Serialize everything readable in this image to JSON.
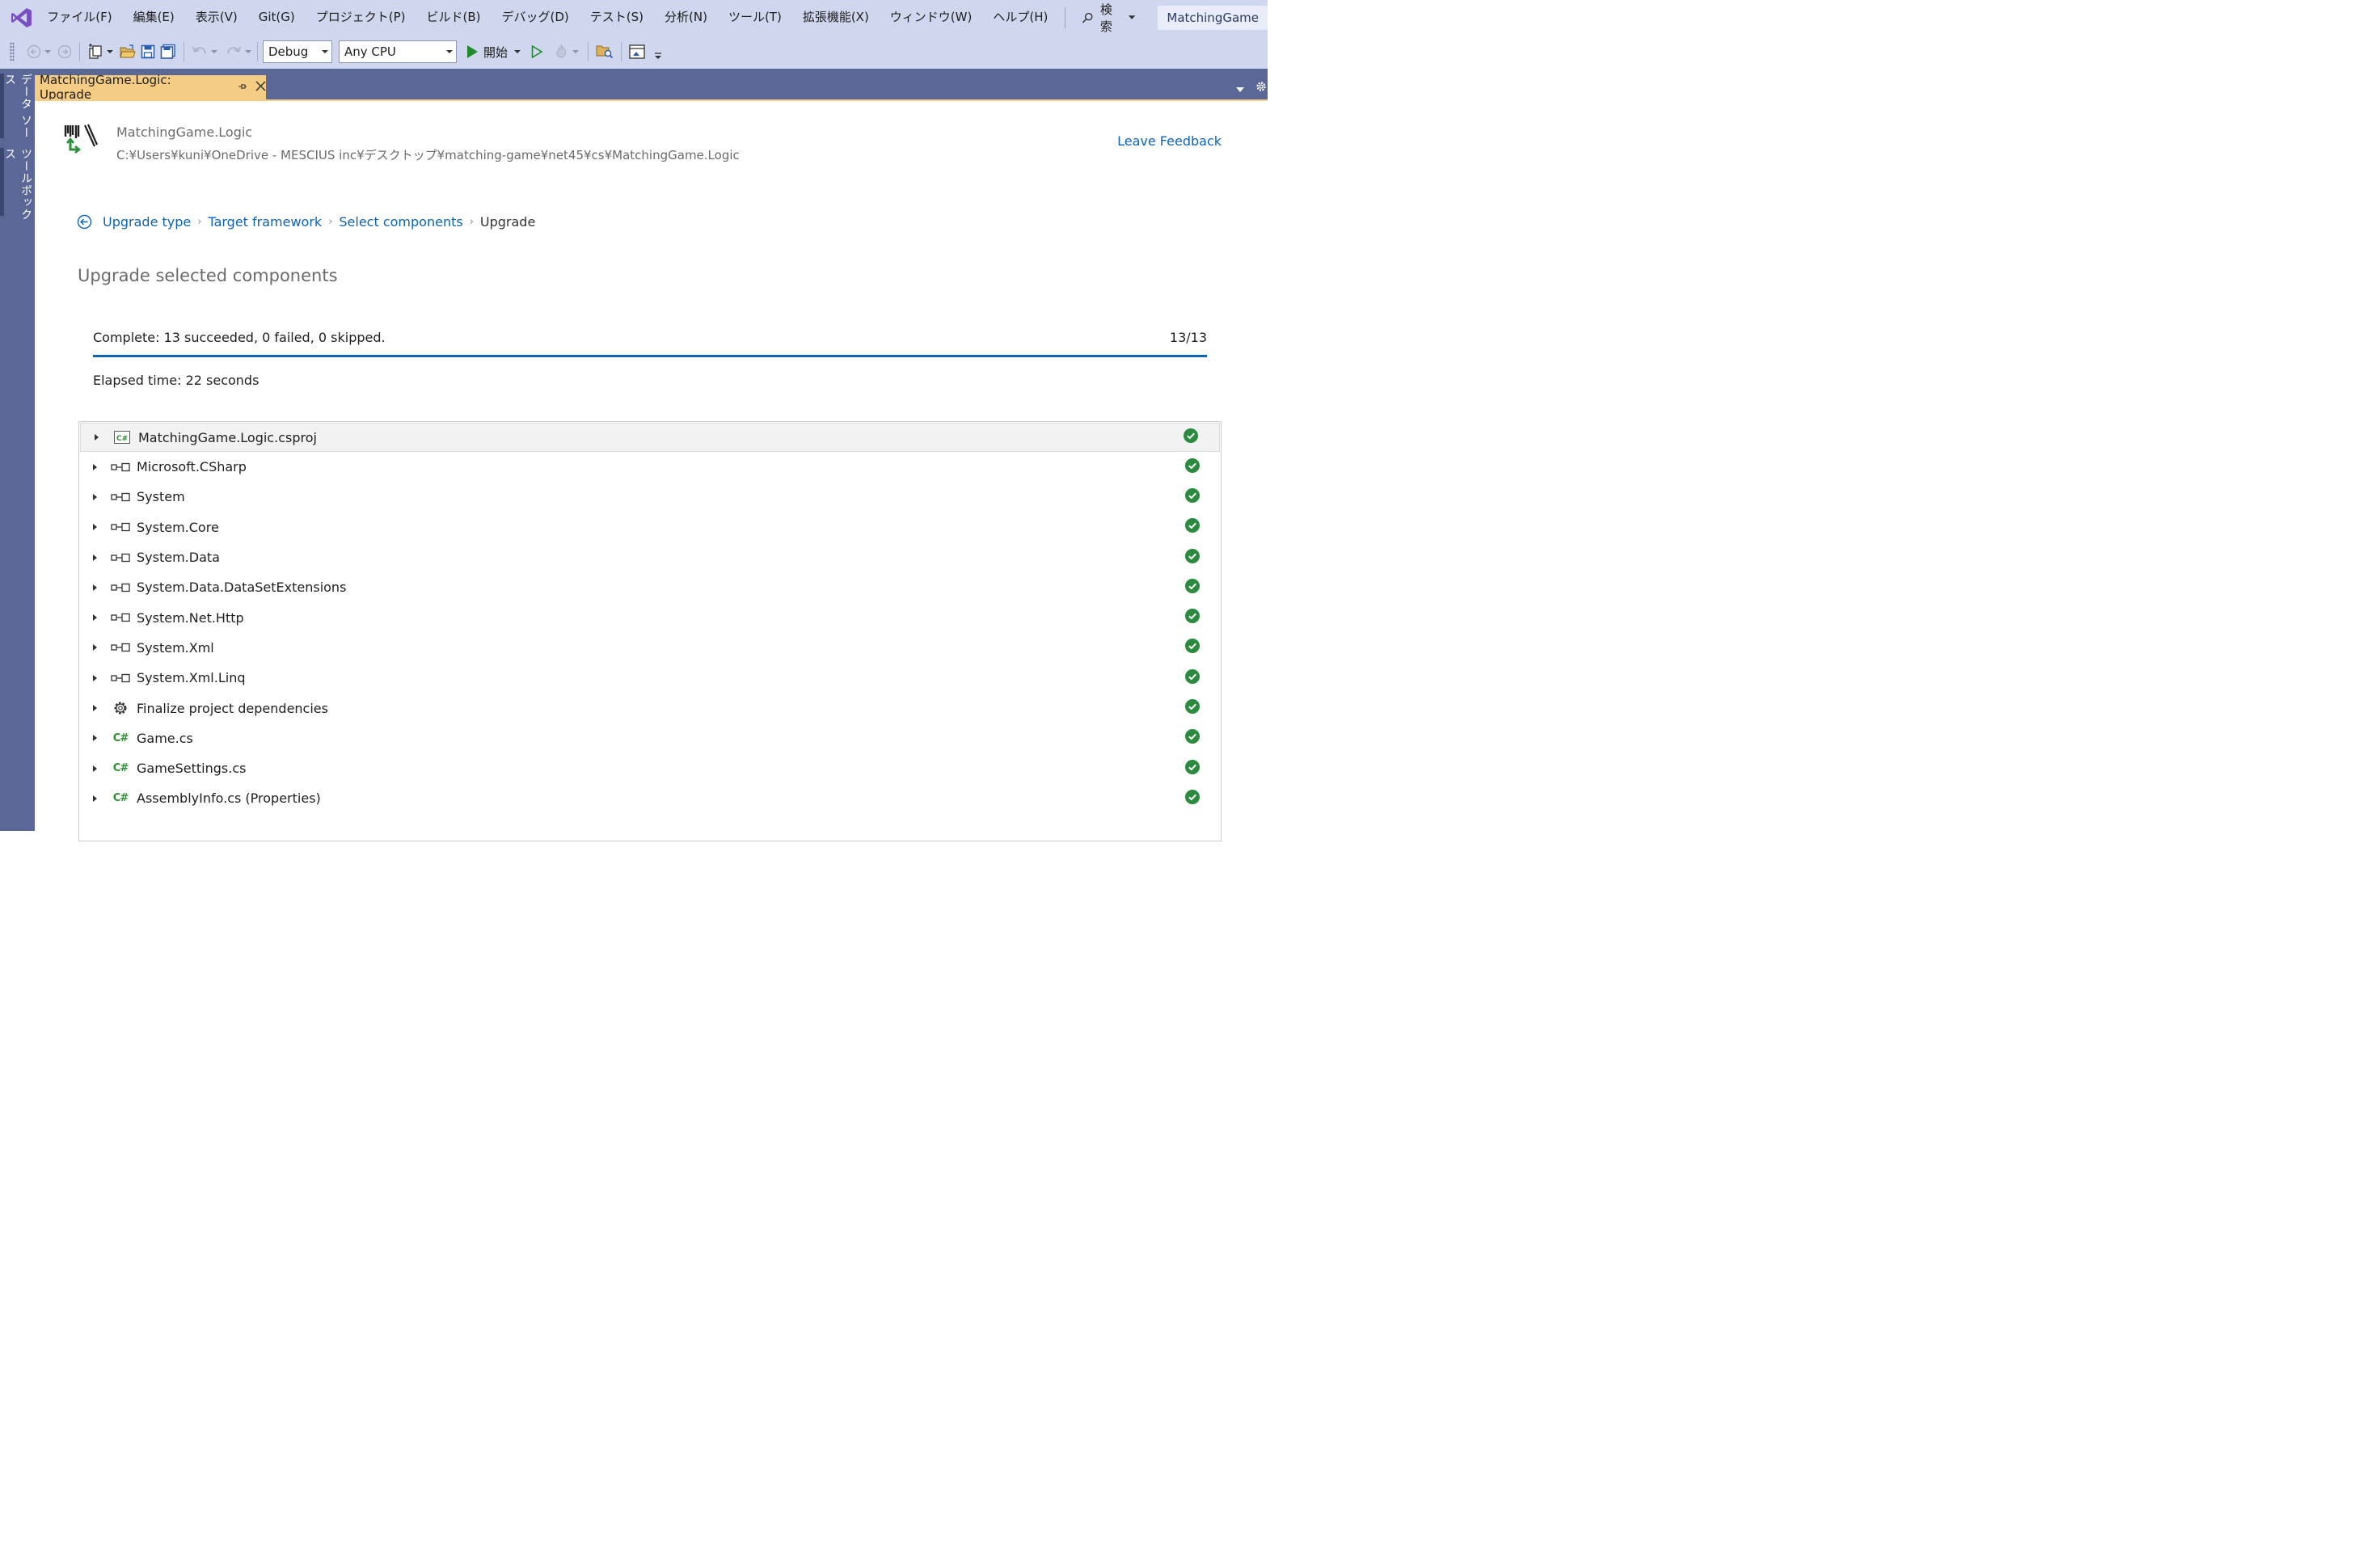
{
  "menubar": {
    "items": [
      "ファイル(F)",
      "編集(E)",
      "表示(V)",
      "Git(G)",
      "プロジェクト(P)",
      "ビルド(B)",
      "デバッグ(D)",
      "テスト(S)",
      "分析(N)",
      "ツール(T)",
      "拡張機能(X)",
      "ウィンドウ(W)",
      "ヘルプ(H)"
    ],
    "search_label": "検索",
    "solution_name": "MatchingGame"
  },
  "toolbar": {
    "config": "Debug",
    "platform": "Any CPU",
    "start_label": "開始"
  },
  "left_tabs": [
    "データ ソース",
    "ツールボックス"
  ],
  "document_tab": {
    "title": "MatchingGame.Logic: Upgrade"
  },
  "header": {
    "project_name": "MatchingGame.Logic",
    "project_path": "C:¥Users¥kuni¥OneDrive - MESCIUS inc¥デスクトップ¥matching-game¥net45¥cs¥MatchingGame.Logic",
    "feedback_link": "Leave Feedback"
  },
  "breadcrumb": {
    "steps": [
      "Upgrade type",
      "Target framework",
      "Select components"
    ],
    "current": "Upgrade"
  },
  "section_title": "Upgrade selected components",
  "status": {
    "summary": "Complete: 13 succeeded, 0 failed, 0 skipped.",
    "count": "13/13",
    "progress": 1.0,
    "elapsed": "Elapsed time: 22 seconds"
  },
  "items": [
    {
      "label": "MatchingGame.Logic.csproj",
      "icon": "csproj-icon",
      "status": "succeeded"
    },
    {
      "label": "Microsoft.CSharp",
      "icon": "reference-icon",
      "status": "succeeded"
    },
    {
      "label": "System",
      "icon": "reference-icon",
      "status": "succeeded"
    },
    {
      "label": "System.Core",
      "icon": "reference-icon",
      "status": "succeeded"
    },
    {
      "label": "System.Data",
      "icon": "reference-icon",
      "status": "succeeded"
    },
    {
      "label": "System.Data.DataSetExtensions",
      "icon": "reference-icon",
      "status": "succeeded"
    },
    {
      "label": "System.Net.Http",
      "icon": "reference-icon",
      "status": "succeeded"
    },
    {
      "label": "System.Xml",
      "icon": "reference-icon",
      "status": "succeeded"
    },
    {
      "label": "System.Xml.Linq",
      "icon": "reference-icon",
      "status": "succeeded"
    },
    {
      "label": "Finalize project dependencies",
      "icon": "gear-icon",
      "status": "succeeded"
    },
    {
      "label": "Game.cs",
      "icon": "csharp-file-icon",
      "status": "succeeded"
    },
    {
      "label": "GameSettings.cs",
      "icon": "csharp-file-icon",
      "status": "succeeded"
    },
    {
      "label": "AssemblyInfo.cs (Properties)",
      "icon": "csharp-file-icon",
      "status": "succeeded"
    }
  ],
  "colors": {
    "accent": "#0e63b2",
    "success": "#2a8a3e",
    "tab_active": "#f5cc84",
    "chrome": "#cfd6ee",
    "well": "#5a6797"
  }
}
